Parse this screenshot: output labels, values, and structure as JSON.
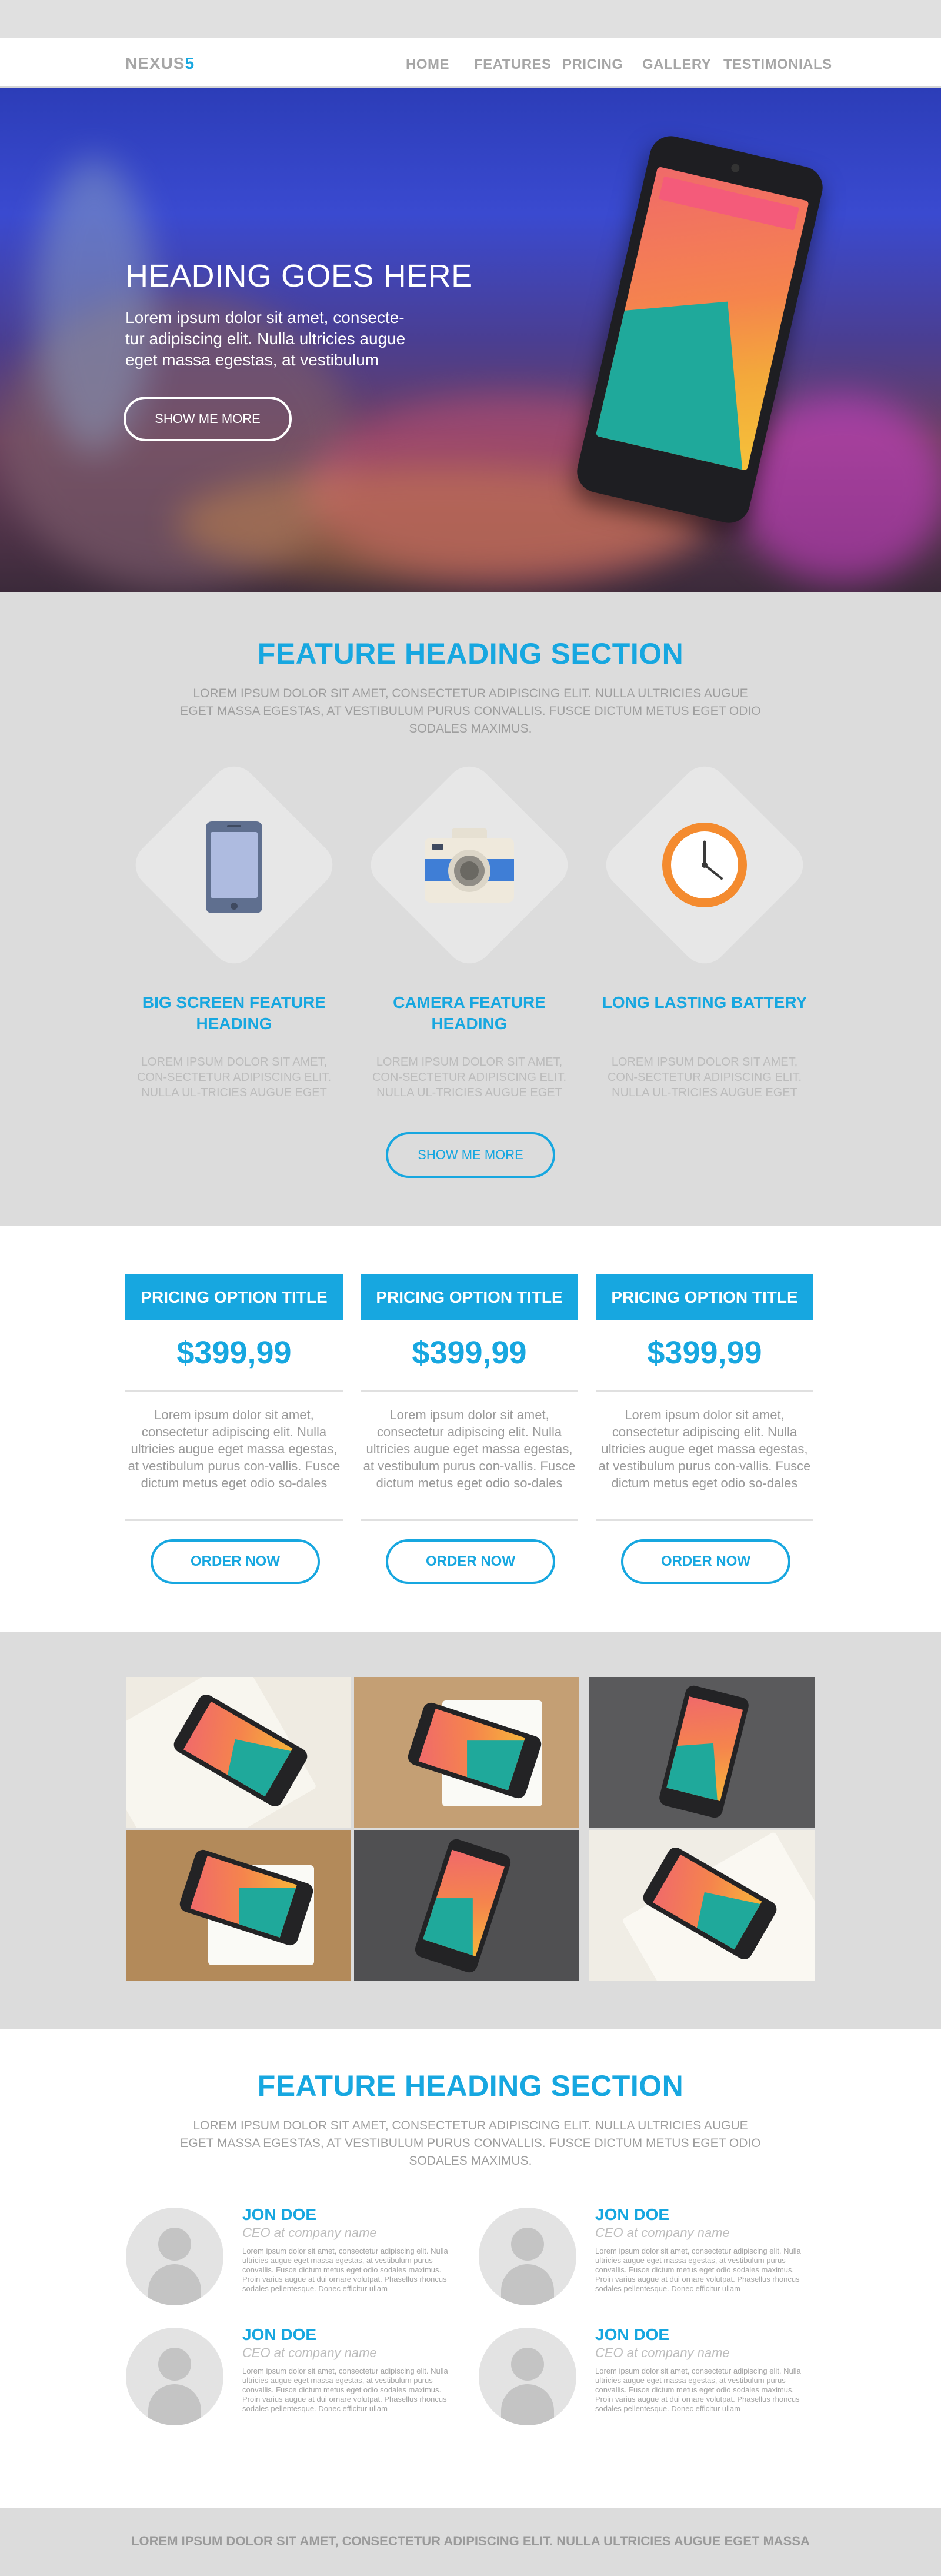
{
  "nav": {
    "logo_text": "NEXUS",
    "logo_accent": "5",
    "items": [
      "HOME",
      "FEATURES",
      "PRICING",
      "GALLERY",
      "TESTIMONIALS"
    ]
  },
  "hero": {
    "heading": "HEADING GOES HERE",
    "text": "Lorem ipsum dolor sit amet, consecte-tur adipiscing elit. Nulla ultricies augue eget massa egestas, at vestibulum",
    "button": "SHOW ME MORE"
  },
  "features": {
    "heading": "FEATURE HEADING SECTION",
    "subtext": "LOREM IPSUM DOLOR SIT AMET, CONSECTETUR ADIPISCING ELIT. NULLA ULTRICIES AUGUE EGET MASSA EGESTAS, AT VESTIBULUM PURUS CONVALLIS. FUSCE DICTUM METUS EGET ODIO SODALES MAXIMUS.",
    "items": [
      {
        "icon": "smartphone-icon",
        "title": "BIG SCREEN FEATURE HEADING",
        "text": "LOREM IPSUM DOLOR SIT AMET, CON-SECTETUR ADIPISCING ELIT. NULLA UL-TRICIES AUGUE EGET MASSA EGESTAS,"
      },
      {
        "icon": "camera-icon",
        "title": "CAMERA FEATURE HEADING",
        "text": "LOREM IPSUM DOLOR SIT AMET, CON-SECTETUR ADIPISCING ELIT. NULLA UL-TRICIES AUGUE EGET MASSA EGESTAS,"
      },
      {
        "icon": "clock-icon",
        "title": "LONG LASTING BATTERY",
        "text": "LOREM IPSUM DOLOR SIT AMET, CON-SECTETUR ADIPISCING ELIT. NULLA UL-TRICIES AUGUE EGET MASSA EGESTAS,"
      }
    ],
    "button": "SHOW ME MORE"
  },
  "pricing": {
    "plans": [
      {
        "title": "PRICING OPTION TITLE",
        "price": "$399,99",
        "text": "Lorem ipsum dolor sit amet, consectetur adipiscing elit. Nulla ultricies augue eget massa egestas, at vestibulum purus con-vallis. Fusce dictum metus eget odio so-dales maximus. Proin varius augue at dui ornare volutpat. Phasellus rhoncus so-",
        "button": "ORDER NOW"
      },
      {
        "title": "PRICING OPTION TITLE",
        "price": "$399,99",
        "text": "Lorem ipsum dolor sit amet, consectetur adipiscing elit. Nulla ultricies augue eget massa egestas, at vestibulum purus con-vallis. Fusce dictum metus eget odio so-dales maximus. Proin varius augue at dui ornare volutpat. Phasellus rhoncus so-",
        "button": "ORDER NOW"
      },
      {
        "title": "PRICING OPTION TITLE",
        "price": "$399,99",
        "text": "Lorem ipsum dolor sit amet, consectetur adipiscing elit. Nulla ultricies augue eget massa egestas, at vestibulum purus con-vallis. Fusce dictum metus eget odio so-dales maximus. Proin varius augue at dui ornare volutpat. Phasellus rhoncus so-",
        "button": "ORDER NOW"
      }
    ]
  },
  "testimonials": {
    "heading": "FEATURE HEADING SECTION",
    "subtext": "LOREM IPSUM DOLOR SIT AMET, CONSECTETUR ADIPISCING ELIT. NULLA ULTRICIES AUGUE EGET MASSA EGESTAS, AT VESTIBULUM PURUS CONVALLIS. FUSCE DICTUM METUS EGET ODIO SODALES MAXIMUS.",
    "people": [
      {
        "name": "JON DOE",
        "role": "CEO at company name",
        "text": "Lorem ipsum dolor sit amet, consectetur adipiscing elit. Nulla ultricies augue eget massa egestas, at vestibulum purus convallis. Fusce dictum metus eget odio sodales maximus. Proin varius augue at dui ornare volutpat. Phasellus rhoncus sodales pellentesque. Donec efficitur ullam"
      },
      {
        "name": "JON DOE",
        "role": "CEO at company name",
        "text": "Lorem ipsum dolor sit amet, consectetur adipiscing elit. Nulla ultricies augue eget massa egestas, at vestibulum purus convallis. Fusce dictum metus eget odio sodales maximus. Proin varius augue at dui ornare volutpat. Phasellus rhoncus sodales pellentesque. Donec efficitur ullam"
      },
      {
        "name": "JON DOE",
        "role": "CEO at company name",
        "text": "Lorem ipsum dolor sit amet, consectetur adipiscing elit. Nulla ultricies augue eget massa egestas, at vestibulum purus convallis. Fusce dictum metus eget odio sodales maximus. Proin varius augue at dui ornare volutpat. Phasellus rhoncus sodales pellentesque. Donec efficitur ullam"
      },
      {
        "name": "JON DOE",
        "role": "CEO at company name",
        "text": "Lorem ipsum dolor sit amet, consectetur adipiscing elit. Nulla ultricies augue eget massa egestas, at vestibulum purus convallis. Fusce dictum metus eget odio sodales maximus. Proin varius augue at dui ornare volutpat. Phasellus rhoncus sodales pellentesque. Donec efficitur ullam"
      }
    ]
  },
  "footer": {
    "text": "LOREM IPSUM DOLOR SIT AMET, CONSECTETUR ADIPISCING ELIT. NULLA ULTRICIES AUGUE EGET MASSA"
  },
  "colors": {
    "accent": "#17a7e0",
    "gray_bg": "#dcdcdc",
    "text_gray": "#a6a6a6"
  }
}
